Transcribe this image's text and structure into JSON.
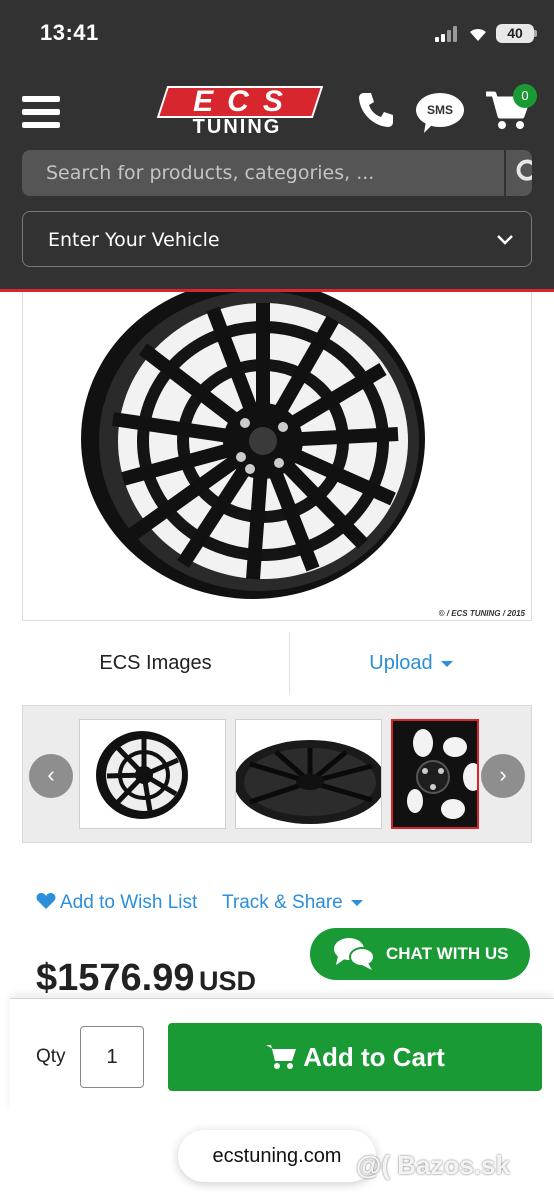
{
  "status": {
    "time": "13:41",
    "battery": "40"
  },
  "header": {
    "logo_text": "ECS",
    "logo_sub": "TUNING",
    "sms_label": "SMS",
    "cart_count": "0",
    "search_placeholder": "Search for products, categories, ...",
    "vehicle_label": "Enter Your Vehicle",
    "accent_color": "#d8262f",
    "background_color": "#323232"
  },
  "product_image": {
    "watermark": "© / ECS TUNING / 2015"
  },
  "image_tabs": {
    "ecs_images": "ECS Images",
    "upload": "Upload"
  },
  "gallery": {
    "prev_icon": "‹",
    "next_icon": "›"
  },
  "actions": {
    "wish_list": "Add to Wish List",
    "track_share": "Track & Share"
  },
  "chat": {
    "label": "CHAT WITH US"
  },
  "price": {
    "amount": "$1576.99",
    "currency": "USD"
  },
  "cart": {
    "qty_label": "Qty",
    "qty_value": "1",
    "add_label": "Add to Cart",
    "button_color": "#1a9a35"
  },
  "browser": {
    "url": "ecstuning.com"
  },
  "overlay": {
    "watermark": "@( Bazos.sk"
  }
}
